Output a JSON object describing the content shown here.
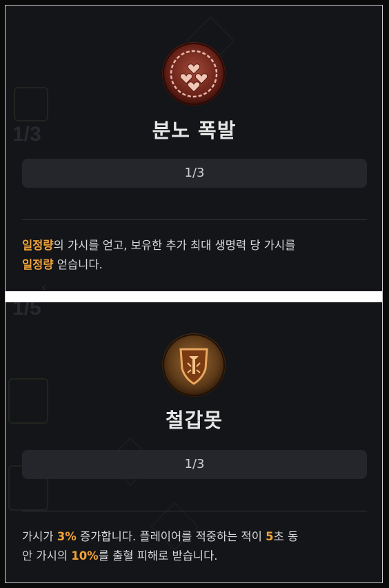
{
  "skills": [
    {
      "icon": "heart-thorn-icon",
      "title": "분노 폭발",
      "rank": "1/3",
      "description": {
        "hl1": "일정량",
        "t1": "의 가시를 얻고, 보유한 추가 최대 생명력 당 가시를",
        "hl2": "일정량",
        "t2": " 얻습니다."
      }
    },
    {
      "icon": "nail-shield-icon",
      "title": "철갑못",
      "rank": "1/3",
      "description": {
        "t1": "가시가 ",
        "hl1": "3%",
        "t2": " 증가합니다. 플레이어를 적중하는 적이 ",
        "hl2": "5",
        "t3": "초 동",
        "t4": "안 가시의 ",
        "hl3": "10%",
        "t5": "를 출혈 피해로 받습니다."
      }
    }
  ],
  "background": {
    "ghost_rank_top": "1/3",
    "ghost_rank_bottom": "1/5"
  },
  "colors": {
    "highlight": "#f0a33a",
    "panel": "#141518",
    "bar": "#25262c"
  }
}
